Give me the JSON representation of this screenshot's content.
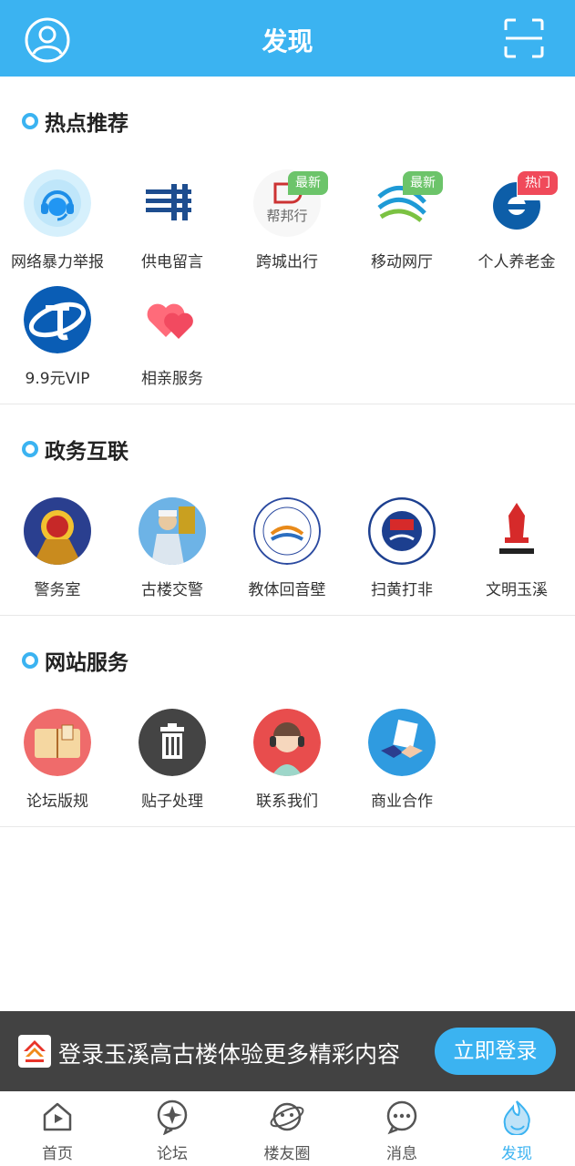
{
  "header": {
    "title": "发现"
  },
  "sections": [
    {
      "title": "热点推荐",
      "items": [
        {
          "label": "网络暴力举报",
          "icon": "headset-icon"
        },
        {
          "label": "供电留言",
          "icon": "power-grid-logo-icon"
        },
        {
          "label": "跨城出行",
          "icon": "bangbang-logo-icon",
          "badge": "最新"
        },
        {
          "label": "移动网厅",
          "icon": "china-mobile-logo-icon",
          "badge": "最新"
        },
        {
          "label": "个人养老金",
          "icon": "ccb-logo-icon",
          "badge": "热门"
        },
        {
          "label": "9.9元VIP",
          "icon": "china-telecom-logo-icon"
        },
        {
          "label": "相亲服务",
          "icon": "hearts-icon"
        }
      ]
    },
    {
      "title": "政务互联",
      "items": [
        {
          "label": "警务室",
          "icon": "police-emblem-icon"
        },
        {
          "label": "古楼交警",
          "icon": "traffic-police-icon"
        },
        {
          "label": "教体回音壁",
          "icon": "education-bureau-seal-icon"
        },
        {
          "label": "扫黄打非",
          "icon": "anti-porn-seal-icon"
        },
        {
          "label": "文明玉溪",
          "icon": "civilized-yuxi-logo-icon"
        }
      ]
    },
    {
      "title": "网站服务",
      "items": [
        {
          "label": "论坛版规",
          "icon": "rulebook-icon"
        },
        {
          "label": "贴子处理",
          "icon": "trash-icon"
        },
        {
          "label": "联系我们",
          "icon": "customer-service-icon"
        },
        {
          "label": "商业合作",
          "icon": "handshake-icon"
        }
      ]
    }
  ],
  "login_banner": {
    "text": "登录玉溪高古楼体验更多精彩内容",
    "button": "立即登录"
  },
  "tabbar": [
    {
      "label": "首页",
      "icon": "home-icon"
    },
    {
      "label": "论坛",
      "icon": "forum-icon"
    },
    {
      "label": "楼友圈",
      "icon": "planet-icon"
    },
    {
      "label": "消息",
      "icon": "message-icon"
    },
    {
      "label": "发现",
      "icon": "discover-flame-icon",
      "active": true
    }
  ],
  "colors": {
    "accent": "#3bb3f1",
    "badge_new": "#6cc46a",
    "badge_hot": "#f04a5a"
  }
}
